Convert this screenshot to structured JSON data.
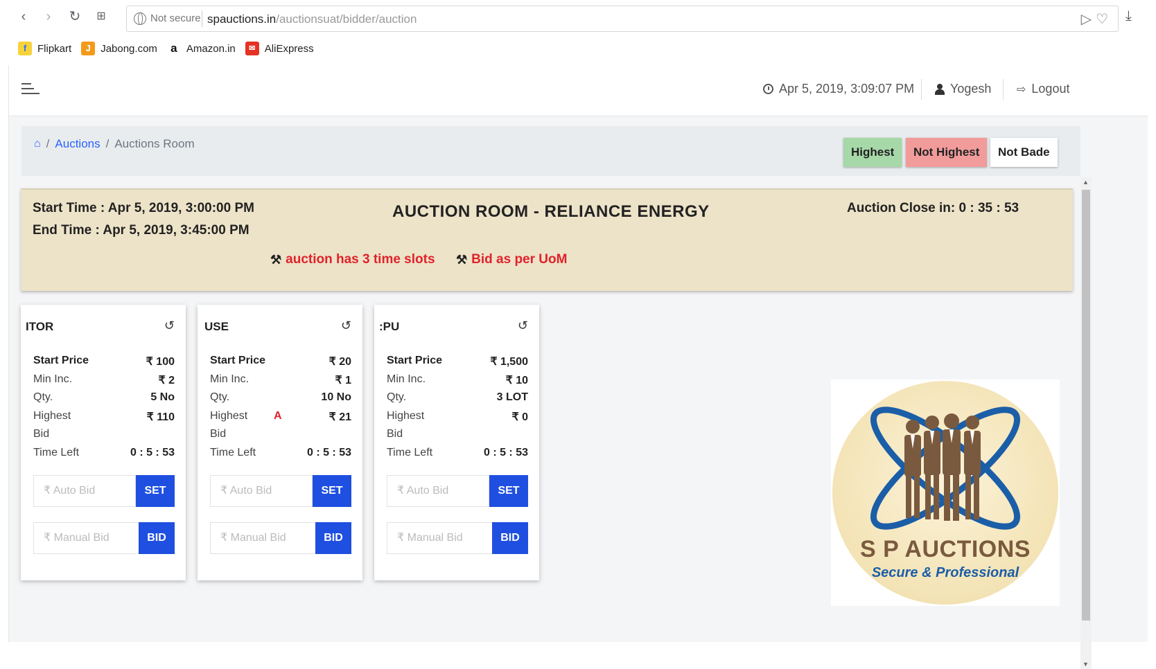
{
  "browser": {
    "not_secure": "Not secure",
    "url_host": "spauctions.in",
    "url_path": "/auctionsuat/bidder/auction",
    "bookmarks": [
      {
        "label": "Flipkart",
        "color": "#f7d23a",
        "glyph": "f"
      },
      {
        "label": "Jabong.com",
        "color": "#f39a1b",
        "glyph": "J"
      },
      {
        "label": "Amazon.in",
        "color": "#ffffff",
        "glyph": "a"
      },
      {
        "label": "AliExpress",
        "color": "#e43225",
        "glyph": "✉"
      }
    ]
  },
  "topbar": {
    "datetime": "Apr 5, 2019, 3:09:07 PM",
    "user": "Yogesh",
    "logout": "Logout"
  },
  "breadcrumb": {
    "home_icon": "home-icon",
    "auctions": "Auctions",
    "current": "Auctions Room",
    "sep": "/"
  },
  "legend": {
    "highest": {
      "label": "Highest",
      "color": "#a6d8a8"
    },
    "not_highest": {
      "label": "Not Highest",
      "color": "#f29b9b"
    },
    "not_bade": {
      "label": "Not Bade",
      "color": "#ffffff"
    }
  },
  "banner": {
    "start_time": "Start Time : Apr 5, 2019, 3:00:00 PM",
    "end_time": "End Time : Apr 5, 2019, 3:45:00 PM",
    "title": "AUCTION ROOM - RELIANCE ENERGY",
    "close_in": "Auction Close in: 0 : 35 : 53",
    "notice_slots": "auction has 3 time slots",
    "notice_uom": "Bid as per UoM"
  },
  "cards": [
    {
      "name": "ITOR",
      "start_price_label": "Start Price",
      "start_price": "₹ 100",
      "min_inc_label": "Min Inc.",
      "min_inc": "₹ 2",
      "qty_label": "Qty.",
      "qty": "5 No",
      "highest_label": "Highest",
      "highest": "₹ 110",
      "status_mark": "",
      "bid_label": "Bid",
      "time_left_label": "Time Left",
      "time_left": "0 : 5 : 53",
      "auto_bid_placeholder": "₹ Auto Bid",
      "set_label": "SET",
      "manual_bid_placeholder": "₹ Manual Bid",
      "bid_button": "BID"
    },
    {
      "name": "USE",
      "start_price_label": "Start Price",
      "start_price": "₹ 20",
      "min_inc_label": "Min Inc.",
      "min_inc": "₹ 1",
      "qty_label": "Qty.",
      "qty": "10 No",
      "highest_label": "Highest",
      "highest": "₹ 21",
      "status_mark": "A",
      "bid_label": "Bid",
      "time_left_label": "Time Left",
      "time_left": "0 : 5 : 53",
      "auto_bid_placeholder": "₹ Auto Bid",
      "set_label": "SET",
      "manual_bid_placeholder": "₹ Manual Bid",
      "bid_button": "BID"
    },
    {
      "name": ":PU",
      "start_price_label": "Start Price",
      "start_price": "₹ 1,500",
      "min_inc_label": "Min Inc.",
      "min_inc": "₹ 10",
      "qty_label": "Qty.",
      "qty": "3 LOT",
      "highest_label": "Highest",
      "highest": "₹ 0",
      "status_mark": "",
      "bid_label": "Bid",
      "time_left_label": "Time Left",
      "time_left": "0 : 5 : 53",
      "auto_bid_placeholder": "₹ Auto Bid",
      "set_label": "SET",
      "manual_bid_placeholder": "₹ Manual Bid",
      "bid_button": "BID"
    }
  ],
  "logo": {
    "brand": "S P AUCTIONS",
    "tagline": "Secure & Professional"
  }
}
